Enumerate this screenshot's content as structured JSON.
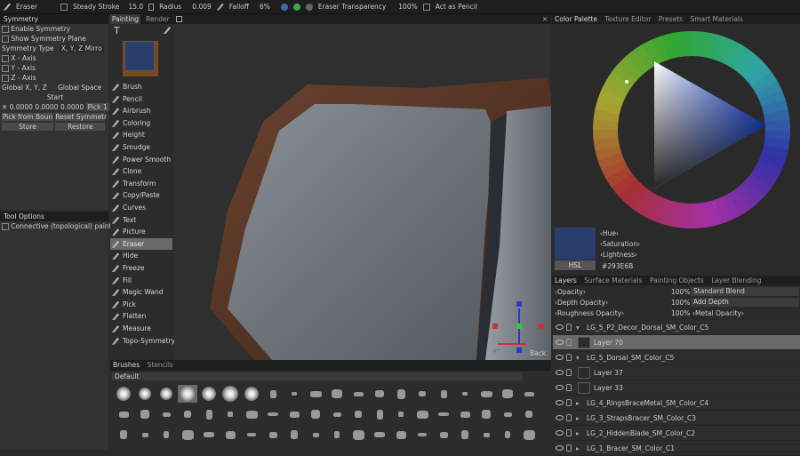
{
  "toolbar": {
    "tool": "Eraser",
    "steady": "Steady Stroke",
    "steady_val": "15.0",
    "radius": "Radius",
    "radius_val": "0.009",
    "falloff": "Falloff",
    "falloff_val": "6%",
    "eraser_transp": "Eraser Transparency",
    "eraser_val": "100%",
    "act_pencil": "Act as Pencil"
  },
  "symmetry": {
    "title": "Symmetry",
    "enable": "Enable Symmetry",
    "show_plane": "Show Symmetry Plane",
    "type_label": "Symmetry Type",
    "type_val": "X, Y, Z Mirro",
    "x_axis": "X - Axis",
    "y_axis": "Y - Axis",
    "z_axis": "Z - Axis",
    "global_label": "Global X, Y, Z",
    "space_val": "Global Space",
    "start": "Start",
    "v1": "0.0000",
    "v2": "0.0000",
    "v3": "0.0000",
    "pick1": "Pick 1",
    "pick_bounds": "Pick from Boun",
    "reset": "Reset Symmetr",
    "store": "Store",
    "restore": "Restore"
  },
  "tool_options": {
    "title": "Tool Options",
    "connective": "Connective (topological) paintin"
  },
  "viewport_tabs": {
    "painting": "Painting",
    "render": "Render"
  },
  "tools": [
    {
      "label": "Brush"
    },
    {
      "label": "Pencil"
    },
    {
      "label": "Airbrush"
    },
    {
      "label": "Coloring"
    },
    {
      "label": "Height"
    },
    {
      "label": "Smudge"
    },
    {
      "label": "Power Smooth"
    },
    {
      "label": "Clone"
    },
    {
      "label": "Transform"
    },
    {
      "label": "Copy/Paste"
    },
    {
      "label": "Curves"
    },
    {
      "label": "Text"
    },
    {
      "label": "Picture"
    },
    {
      "label": "Eraser"
    },
    {
      "label": "Hide"
    },
    {
      "label": "Freeze"
    },
    {
      "label": "Fill"
    },
    {
      "label": "Magic Wand"
    },
    {
      "label": "Pick"
    },
    {
      "label": "Flatten"
    },
    {
      "label": "Measure"
    },
    {
      "label": "Topo-Symmetry"
    }
  ],
  "viewport": {
    "back": "Back"
  },
  "brushes": {
    "tab1": "Brushes",
    "tab2": "Stencils",
    "preset": "Default"
  },
  "color": {
    "tabs": [
      "Color Palette",
      "Texture Editor",
      "Presets",
      "Smart Materials"
    ],
    "hue": "Hue",
    "saturation": "Saturation",
    "lightness": "Lightness",
    "mode": "HSL",
    "hex": "#293E6B",
    "swatch": "#293e6b",
    "sub": "#7a4a1a"
  },
  "layers": {
    "tabs": [
      "Layers",
      "Surface Materials",
      "Painting Objects",
      "Layer Blending"
    ],
    "opacity": "Opacity",
    "opacity_val": "100%",
    "blend": "Standard Blend",
    "depth": "Depth Opacity",
    "depth_val": "100%",
    "add_depth": "Add Depth",
    "rough": "Roughness Opacity",
    "rough_val": "100%",
    "metal": "Metal Opacity",
    "rows": [
      {
        "label": "LG_5_P2_Decor_Dorsal_SM_Color_C5"
      },
      {
        "label": "Layer 70"
      },
      {
        "label": "LG_5_Dorsal_SM_Color_C5"
      },
      {
        "label": "Layer 37"
      },
      {
        "label": "Layer 33"
      },
      {
        "label": "LG_4_RingsBraceMetal_SM_Color_C4"
      },
      {
        "label": "LG_3_StrapsBracer_SM_Color_C3"
      },
      {
        "label": "LG_2_HiddenBlade_SM_Color_C2"
      },
      {
        "label": "LG_1_Bracer_SM_Color_C1"
      }
    ]
  }
}
